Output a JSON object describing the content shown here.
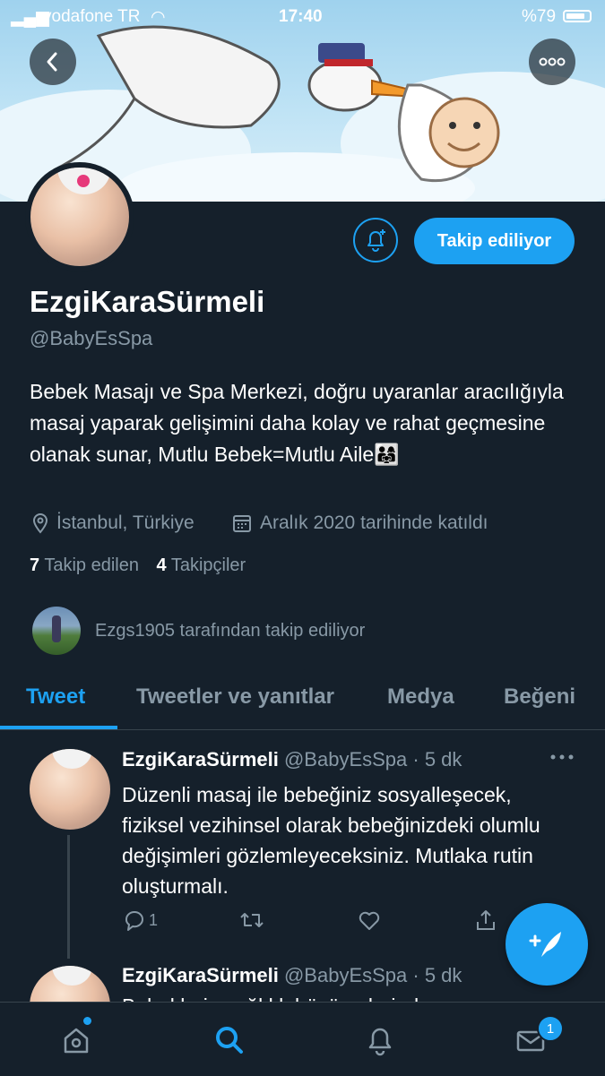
{
  "status_bar": {
    "carrier": "vodafone TR",
    "time": "17:40",
    "battery": "%79"
  },
  "header": {
    "back_icon": "chevron-left-icon",
    "more_icon": "ellipsis-icon"
  },
  "profile": {
    "display_name": "EzgiKaraSürmeli",
    "handle": "@BabyEsSpa",
    "bio": "Bebek Masajı ve Spa Merkezi, doğru uyaranlar aracılığıyla masaj yaparak gelişimini daha kolay ve rahat geçmesine olanak sunar, Mutlu Bebek=Mutlu Aile👨‍👩‍👧",
    "location": "İstanbul, Türkiye",
    "joined": "Aralık 2020 tarihinde katıldı",
    "following_count": "7",
    "following_label": "Takip edilen",
    "followers_count": "4",
    "followers_label": "Takipçiler",
    "follow_button": "Takip ediliyor",
    "followed_by": "Ezgs1905 tarafından takip ediliyor"
  },
  "tabs": [
    "Tweet",
    "Tweetler ve yanıtlar",
    "Medya",
    "Beğeni"
  ],
  "tweets": [
    {
      "name": "EzgiKaraSürmeli",
      "handle": "@BabyEsSpa",
      "time": "· 5 dk",
      "text": "Düzenli masaj ile bebeğiniz sosyalleşecek, fiziksel vezihinsel olarak bebeğinizdeki olumlu değişimleri gözlemleyeceksiniz. Mutlaka rutin oluşturmalı.",
      "replies": "1"
    },
    {
      "name": "EzgiKaraSürmeli",
      "handle": "@BabyEsSpa",
      "time": "· 5 dk",
      "text": "Bebeklerin sağlıklı büyümelerinde ..."
    }
  ],
  "bottom_nav": {
    "messages_badge": "1"
  },
  "colors": {
    "background": "#15202b",
    "accent": "#1da1f2",
    "muted": "#8899a6",
    "border": "#38444d"
  }
}
